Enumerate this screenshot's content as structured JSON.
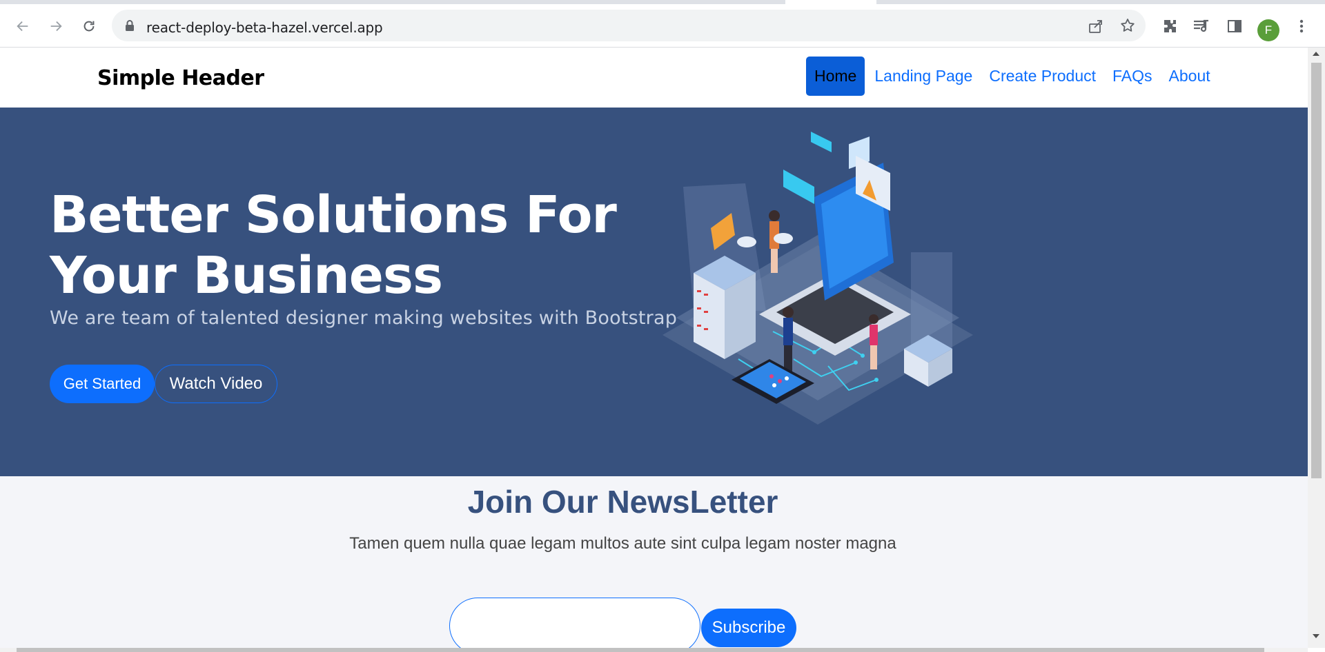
{
  "browser": {
    "url": "react-deploy-beta-hazel.vercel.app",
    "profile_initial": "F",
    "icons": [
      "back-icon",
      "forward-icon",
      "reload-icon",
      "lock-icon",
      "share-icon",
      "star-icon",
      "extensions-icon",
      "media-icon",
      "side-panel-icon",
      "menu-icon"
    ]
  },
  "header": {
    "brand": "Simple Header",
    "nav": [
      {
        "label": "Home",
        "active": true
      },
      {
        "label": "Landing Page"
      },
      {
        "label": "Create Product"
      },
      {
        "label": "FAQs"
      },
      {
        "label": "About"
      }
    ]
  },
  "hero": {
    "title": "Better Solutions For Your Business",
    "subtitle": "We are team of talented designer making websites with Bootstrap",
    "primary_button": "Get Started",
    "secondary_button": "Watch Video",
    "illustration": "isometric-tech-illustration"
  },
  "newsletter": {
    "title": "Join Our NewsLetter",
    "text": "Tamen quem nulla quae legam multos aute sint culpa legam noster magna",
    "email_value": "",
    "button": "Subscribe"
  },
  "colors": {
    "hero_bg": "#37517e",
    "primary": "#0d6efd",
    "active_nav": "#0b5ed7",
    "page_bg": "#f4f5f9"
  }
}
